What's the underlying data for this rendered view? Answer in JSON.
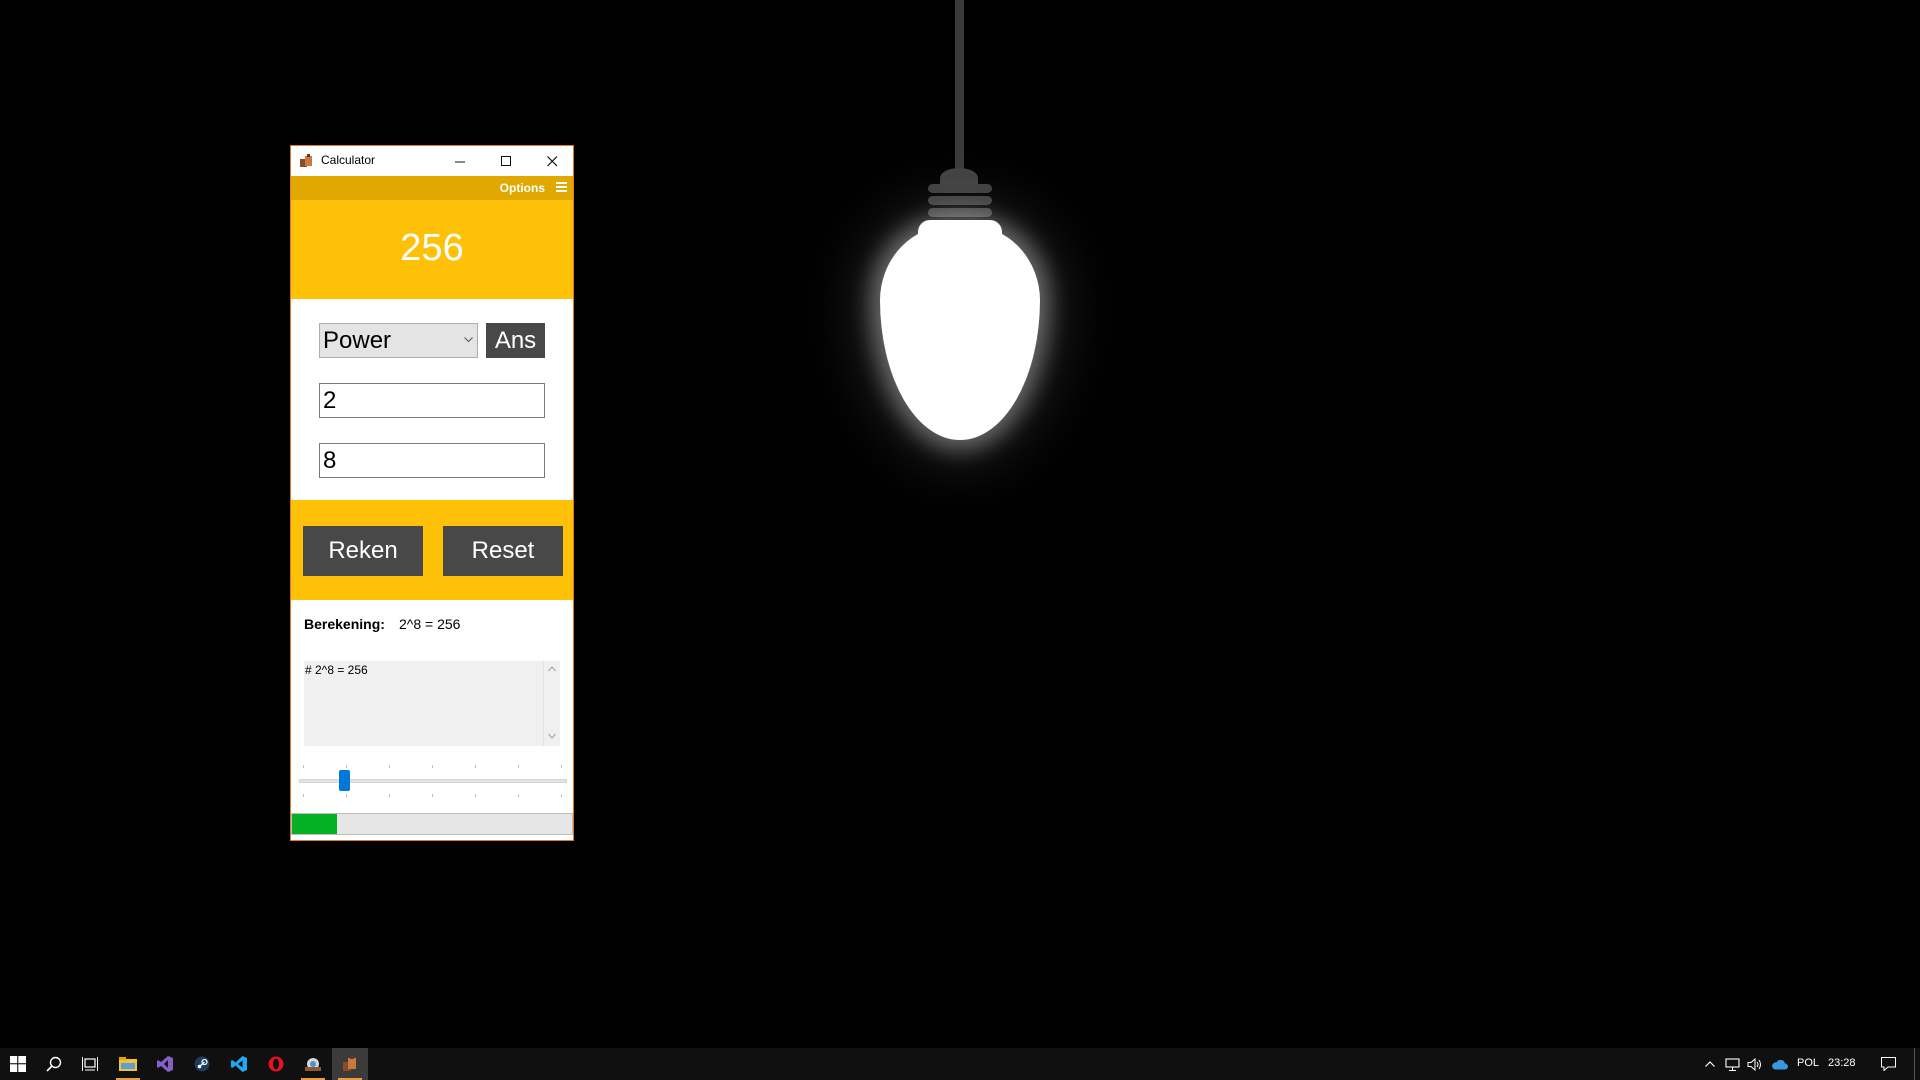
{
  "window": {
    "title": "Calculator",
    "minimize": "—",
    "maximize": "☐",
    "close": "✕"
  },
  "menu": {
    "options_label": "Options"
  },
  "display": {
    "value": "256"
  },
  "operation": {
    "selected": "Power",
    "chevron": "⌄"
  },
  "ans_button": "Ans",
  "inputs": {
    "first": "2",
    "second": "8"
  },
  "buttons": {
    "calculate": "Reken",
    "reset": "Reset"
  },
  "result": {
    "label": "Berekening:",
    "value": "2^8 = 256"
  },
  "history": {
    "text": "# 2^8 = 256"
  },
  "slider": {
    "value_fraction": 0.17
  },
  "progress": {
    "value_fraction": 0.16
  },
  "taskbar": {
    "language": "POL",
    "time": "23:28",
    "items": [
      "start-icon",
      "search-icon",
      "task-view-icon",
      "file-explorer-icon",
      "visual-studio-icon",
      "steam-icon",
      "vscode-icon",
      "opera-icon",
      "game-app-icon",
      "calculator-app-icon"
    ]
  },
  "colors": {
    "accent": "#ffc107",
    "menubar": "#e0a800",
    "button": "#484848",
    "progress": "#06b025",
    "slider": "#0078d7"
  }
}
